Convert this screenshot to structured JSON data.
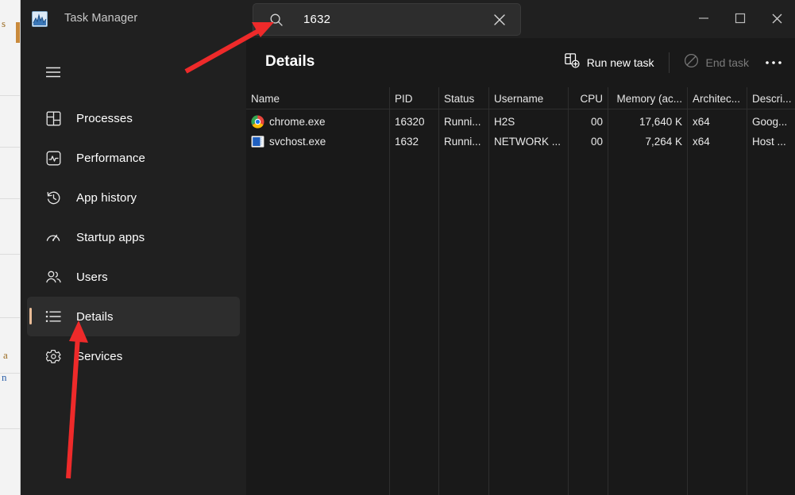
{
  "window": {
    "title": "Task Manager",
    "app_icon": "task-manager-chart-icon",
    "controls": {
      "minimize": "minimize-icon",
      "maximize": "maximize-icon",
      "close": "close-icon"
    }
  },
  "search": {
    "value": "1632",
    "placeholder": "Search",
    "icon": "search-icon",
    "clear_icon": "clear-icon"
  },
  "sidebar": {
    "menu_icon": "hamburger-icon",
    "items": [
      {
        "label": "Processes",
        "icon": "processes-icon",
        "selected": false
      },
      {
        "label": "Performance",
        "icon": "performance-icon",
        "selected": false
      },
      {
        "label": "App history",
        "icon": "app-history-icon",
        "selected": false
      },
      {
        "label": "Startup apps",
        "icon": "startup-apps-icon",
        "selected": false
      },
      {
        "label": "Users",
        "icon": "users-icon",
        "selected": false
      },
      {
        "label": "Details",
        "icon": "details-icon",
        "selected": true
      },
      {
        "label": "Services",
        "icon": "services-icon",
        "selected": false
      }
    ]
  },
  "main": {
    "title": "Details",
    "toolbar": {
      "run_new_task": {
        "label": "Run new task",
        "icon": "run-new-task-icon",
        "enabled": true
      },
      "end_task": {
        "label": "End task",
        "icon": "end-task-icon",
        "enabled": false
      },
      "more": {
        "label": "…",
        "icon": "more-options-icon"
      }
    },
    "table": {
      "sort_column": "Name",
      "sort_direction": "ascending",
      "columns": [
        {
          "key": "name",
          "label": "Name",
          "align": "left"
        },
        {
          "key": "pid",
          "label": "PID",
          "align": "left"
        },
        {
          "key": "status",
          "label": "Status",
          "align": "left"
        },
        {
          "key": "user",
          "label": "Username",
          "align": "left"
        },
        {
          "key": "cpu",
          "label": "CPU",
          "align": "right"
        },
        {
          "key": "memory",
          "label": "Memory (ac...",
          "align": "right"
        },
        {
          "key": "arch",
          "label": "Architec...",
          "align": "left"
        },
        {
          "key": "descr",
          "label": "Descri...",
          "align": "left"
        }
      ],
      "rows": [
        {
          "icon": "chrome-icon",
          "name": "chrome.exe",
          "pid": "16320",
          "status": "Runni...",
          "user": "H2S",
          "cpu": "00",
          "memory": "17,640 K",
          "arch": "x64",
          "descr": "Goog..."
        },
        {
          "icon": "svchost-icon",
          "name": "svchost.exe",
          "pid": "1632",
          "status": "Runni...",
          "user": "NETWORK ...",
          "cpu": "00",
          "memory": "7,264 K",
          "arch": "x64",
          "descr": "Host ..."
        }
      ]
    }
  },
  "annotations": {
    "arrow_color": "#ee2a2a",
    "arrow_search": "arrow-pointing-to-search-box",
    "arrow_details": "arrow-pointing-to-details-tab"
  },
  "background_window": {
    "fragments": [
      "s",
      "a",
      "n"
    ]
  }
}
